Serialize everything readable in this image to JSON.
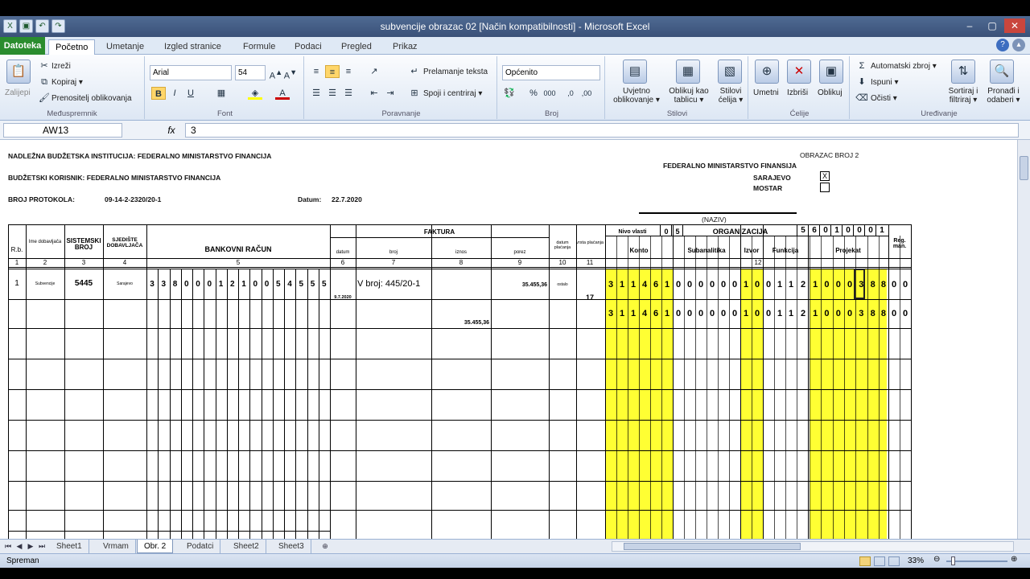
{
  "window": {
    "title": "subvencije obrazac 02  [Način kompatibilnosti] - Microsoft Excel",
    "min": "–",
    "max": "▢",
    "close": "✕"
  },
  "qat": [
    "X",
    "▣",
    "↶",
    "↷"
  ],
  "tabs": [
    "Datoteka",
    "Početno",
    "Umetanje",
    "Izgled stranice",
    "Formule",
    "Podaci",
    "Pregled",
    "Prikaz"
  ],
  "ribbon": {
    "clipboard": {
      "label": "Međuspremnik",
      "paste": "Zalijepi",
      "cut": "Izreži",
      "copy": "Kopiraj ▾",
      "painter": "Prenositelj oblikovanja"
    },
    "font": {
      "label": "Font",
      "name": "Arial",
      "size": "54",
      "bold": "B",
      "italic": "I",
      "underline": "U"
    },
    "alignment": {
      "label": "Poravnanje",
      "wrap": "Prelamanje teksta",
      "merge": "Spoji i centriraj ▾"
    },
    "number": {
      "label": "Broj",
      "format": "Općenito",
      "percent": "%",
      "comma": "000"
    },
    "styles": {
      "label": "Stilovi",
      "conditional": "Uvjetno oblikovanje ▾",
      "as_table": "Oblikuj kao tablicu ▾",
      "cell_styles": "Stilovi ćelija ▾"
    },
    "cells": {
      "label": "Ćelije",
      "insert": "Umetni",
      "delete": "Izbriši",
      "format": "Oblikuj"
    },
    "editing": {
      "label": "Uređivanje",
      "autosum": "Automatski zbroj ▾",
      "fill": "Ispuni ▾",
      "clear": "Očisti ▾",
      "sort": "Sortiraj i filtriraj ▾",
      "find": "Pronađi i odaberi ▾"
    }
  },
  "formula_bar": {
    "cell": "AW13",
    "fx": "fx",
    "value": "3"
  },
  "sheet": {
    "org": "NADLEŽNA BUDŽETSKA INSTITUCIJA: FEDERALNO MINISTARSTVO FINANCIJA",
    "user": "BUDŽETSKI KORISNIK:   FEDERALNO MINISTARSTVO FINANCIJA",
    "protocol": "BROJ PROTOKOLA:",
    "protocol_no": "09-14-2-2320/20-1",
    "date_label": "Datum:",
    "date": "22.7.2020",
    "form": "OBRAZAC BROJ 2",
    "ministry": "FEDERALNO MINISTARSTVO FINANSIJA",
    "city1": "SARAJEVO",
    "city2": "MOSTAR",
    "mark": "X",
    "naziv": "(NAZIV)",
    "h_rb": "R.b.",
    "h_dobav": "Ime dobavljača",
    "h_sistem": "SISTEMSKI BROJ",
    "h_sjediste": "SJEDIŠTE DOBAVLJAČA",
    "h_bank": "BANKOVNI RAČUN",
    "h_faktura": "FAKTURA",
    "h_datum": "datum",
    "h_broj": "broj",
    "h_iznos": "iznos",
    "h_porez": "porez",
    "h_valuta": "datum plaćanja",
    "h_opis": "vrsta plaćanja",
    "h_nivo": "Nivo vlasti",
    "nivo_d1": "0",
    "nivo_d2": "5",
    "h_org": "ORGANIZACIJA",
    "org_digits": [
      "5",
      "6",
      "0",
      "1",
      "0",
      "0",
      "0",
      "1"
    ],
    "h_konto": "Konto",
    "h_subanal": "Subanalitika",
    "h_izvor": "Izvor",
    "h_funk": "Funkcija",
    "h_proj": "Projekat",
    "h_reg": "Reg. man.",
    "nums": [
      "1",
      "2",
      "3",
      "4",
      "5",
      "6",
      "7",
      "8",
      "9",
      "10",
      "11",
      "12"
    ],
    "row": {
      "rb": "1",
      "dobav": "Subvencije",
      "sistem": "5445",
      "sjediste": "Sarajevo",
      "bank": [
        "3",
        "3",
        "8",
        "0",
        "0",
        "0",
        "1",
        "2",
        "1",
        "0",
        "0",
        "5",
        "4",
        "5",
        "5",
        "5"
      ],
      "datum": "9.7.2020",
      "broj": "V broj: 445/20-1",
      "porez": "35.455,36",
      "iznos2": "35.455,36",
      "valuta": "ostalo",
      "opis": "17",
      "code1": [
        "3",
        "1",
        "1",
        "4",
        "6",
        "1",
        "0",
        "0",
        "0",
        "0",
        "0",
        "0",
        "1",
        "0",
        "0",
        "1",
        "1",
        "2",
        "1",
        "0",
        "0",
        "0",
        "3",
        "8",
        "8",
        "0",
        "0"
      ],
      "code2": [
        "3",
        "1",
        "1",
        "4",
        "6",
        "1",
        "0",
        "0",
        "0",
        "0",
        "0",
        "0",
        "1",
        "0",
        "0",
        "1",
        "1",
        "2",
        "1",
        "0",
        "0",
        "0",
        "3",
        "8",
        "8",
        "0",
        "0"
      ]
    }
  },
  "sheet_tabs": [
    "Sheet1",
    "Vrmam",
    "Obr. 2",
    "Podatci",
    "Sheet2",
    "Sheet3"
  ],
  "active_sheet": "Obr. 2",
  "status": {
    "ready": "Spreman",
    "zoom": "33%"
  }
}
